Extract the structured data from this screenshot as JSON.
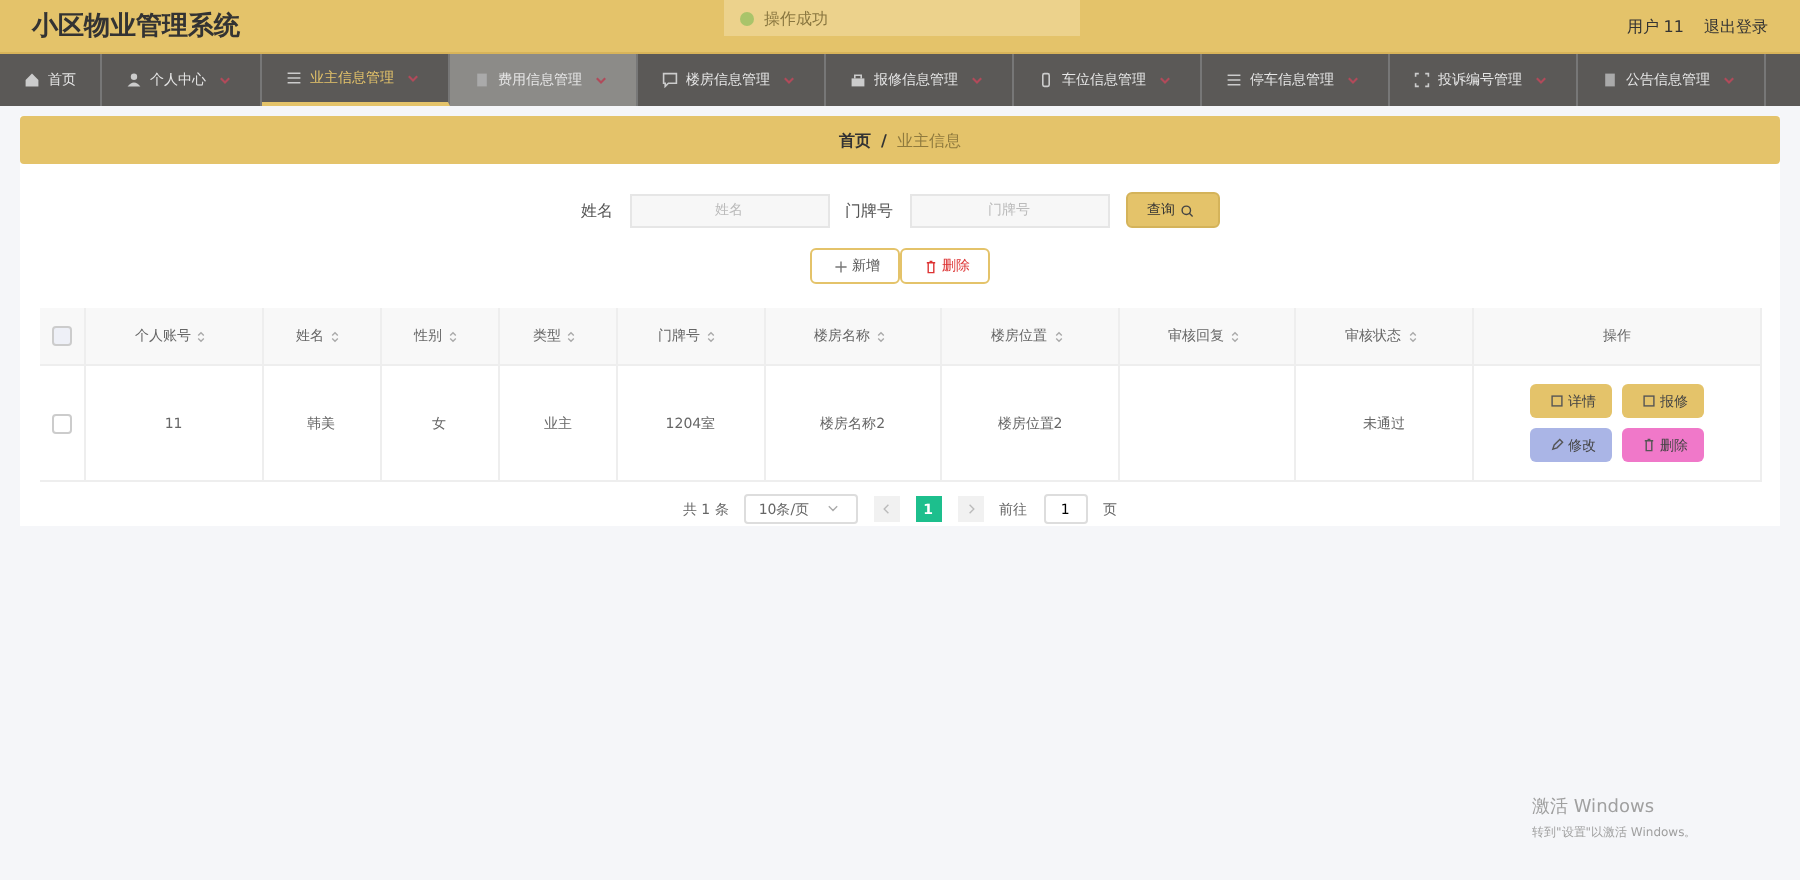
{
  "header": {
    "title": "小区物业管理系统",
    "user": "用户 11",
    "logout": "退出登录"
  },
  "toast": {
    "text": "操作成功"
  },
  "nav": [
    {
      "label": "首页",
      "selected": false,
      "hovered": false,
      "caret": false
    },
    {
      "label": "个人中心",
      "selected": false,
      "hovered": false,
      "caret": true
    },
    {
      "label": "业主信息管理",
      "selected": true,
      "hovered": false,
      "caret": true
    },
    {
      "label": "费用信息管理",
      "selected": false,
      "hovered": true,
      "caret": true
    },
    {
      "label": "楼房信息管理",
      "selected": false,
      "hovered": false,
      "caret": true
    },
    {
      "label": "报修信息管理",
      "selected": false,
      "hovered": false,
      "caret": true
    },
    {
      "label": "车位信息管理",
      "selected": false,
      "hovered": false,
      "caret": true
    },
    {
      "label": "停车信息管理",
      "selected": false,
      "hovered": false,
      "caret": true
    },
    {
      "label": "投诉编号管理",
      "selected": false,
      "hovered": false,
      "caret": true
    },
    {
      "label": "公告信息管理",
      "selected": false,
      "hovered": false,
      "caret": true
    }
  ],
  "breadcrumb": {
    "home": "首页",
    "separator": "/",
    "current": "业主信息"
  },
  "search": {
    "fields": [
      {
        "label": "姓名",
        "placeholder": "姓名"
      },
      {
        "label": "门牌号",
        "placeholder": "门牌号"
      }
    ],
    "button": "查询"
  },
  "actions": [
    {
      "kind": "add",
      "label": "新增"
    },
    {
      "kind": "delete",
      "label": "删除"
    }
  ],
  "table": {
    "all_checked": false,
    "columns": [
      "个人账号",
      "姓名",
      "性别",
      "类型",
      "门牌号",
      "楼房名称",
      "楼房位置",
      "审核回复",
      "审核状态"
    ],
    "ops_column": "操作",
    "rows": [
      {
        "checked": false,
        "cells": [
          "11",
          "韩美",
          "女",
          "业主",
          "1204室",
          "楼房名称2",
          "楼房位置2",
          "",
          "未通过"
        ],
        "buttons": [
          {
            "kind": "detail",
            "label": "详情"
          },
          {
            "kind": "repair",
            "label": "报修"
          },
          {
            "kind": "edit",
            "label": "修改"
          },
          {
            "kind": "delete",
            "label": "删除"
          }
        ]
      }
    ]
  },
  "pagination": {
    "total": "共 1 条",
    "page_size": "10条/页",
    "pages": [
      {
        "label": "1",
        "selected": true
      }
    ],
    "goto_label": "前往",
    "goto_value": "1",
    "goto_suffix": "页"
  },
  "os_notice": {
    "title": "激活 Windows",
    "subtitle": "转到\"设置\"以激活 Windows。"
  }
}
